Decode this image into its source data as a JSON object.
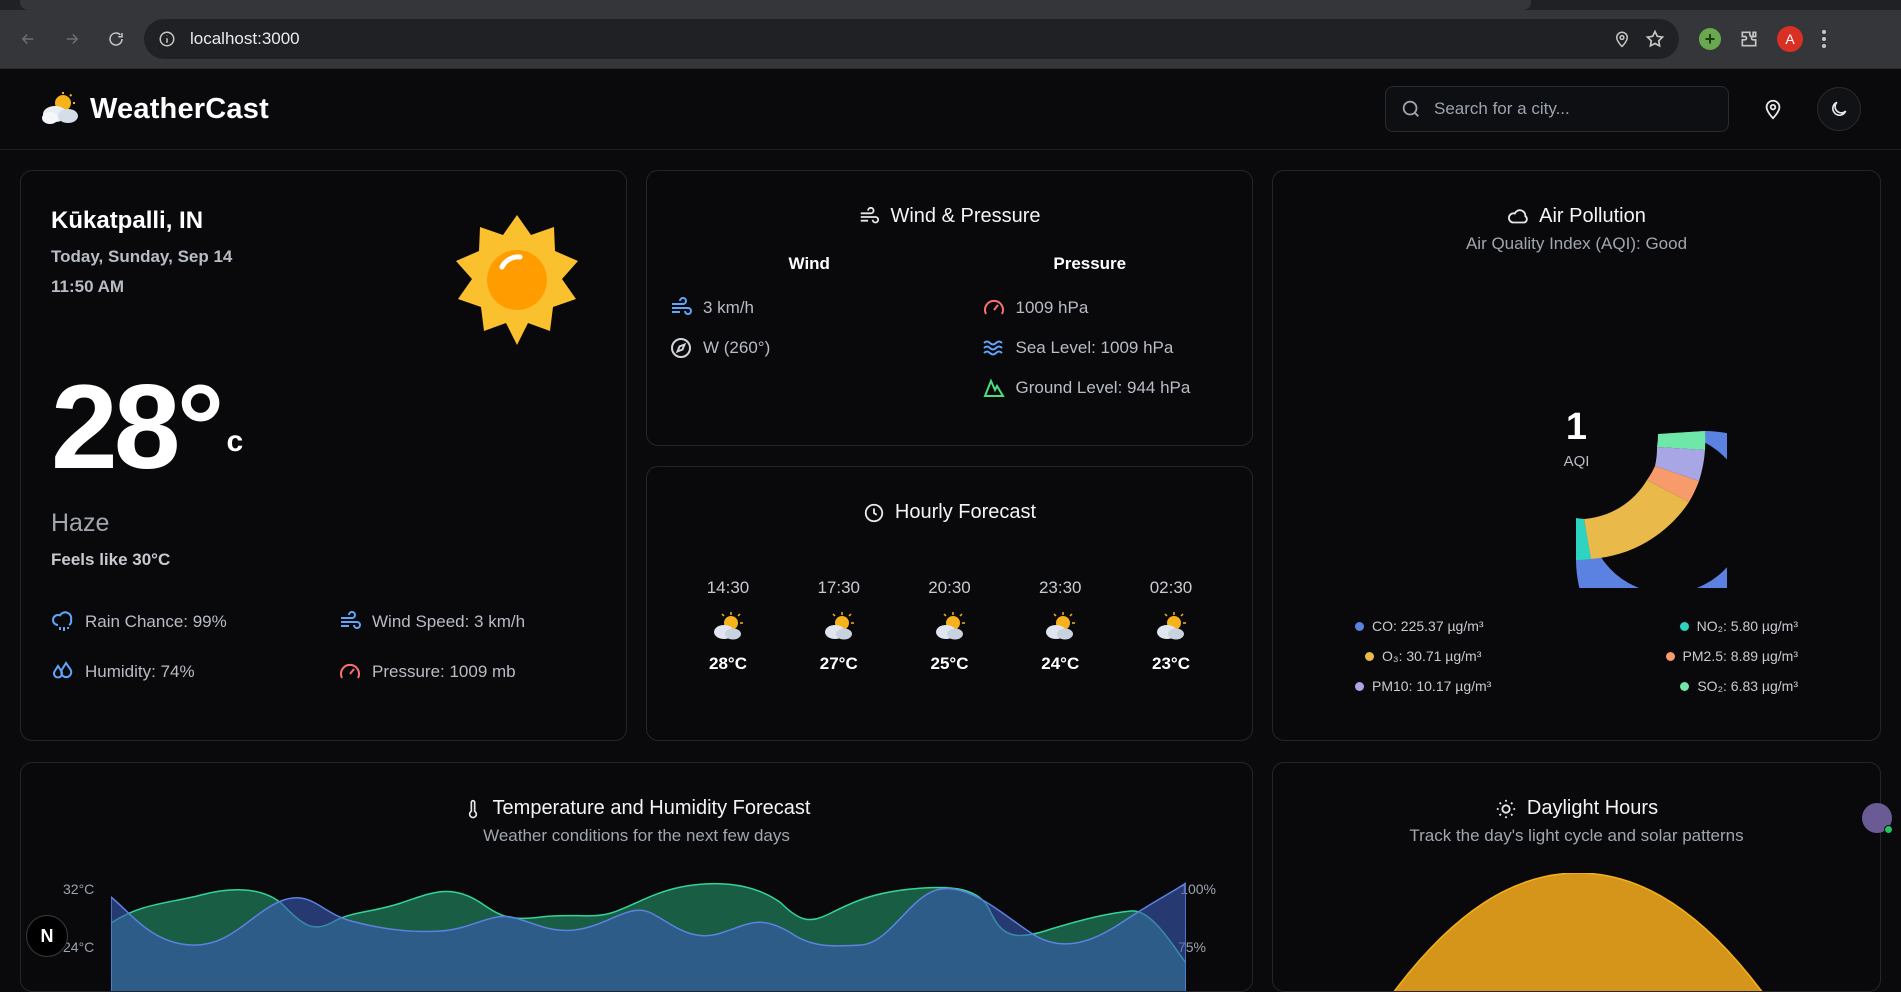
{
  "browser": {
    "url": "localhost:3000",
    "profile_initial": "A"
  },
  "header": {
    "brand": "WeatherCast",
    "search_placeholder": "Search for a city..."
  },
  "current": {
    "city": "Kūkatpalli, IN",
    "date": "Today, Sunday, Sep 14",
    "time": "11:50 AM",
    "temp": "28°",
    "unit": "c",
    "condition": "Haze",
    "feels_like": "Feels like 30°C",
    "stats": {
      "rain": "Rain Chance: 99%",
      "wind": "Wind Speed: 3 km/h",
      "humidity": "Humidity: 74%",
      "pressure": "Pressure: 1009 mb"
    }
  },
  "wind_pressure": {
    "title": "Wind & Pressure",
    "wind_head": "Wind",
    "pressure_head": "Pressure",
    "wind_speed": "3 km/h",
    "wind_dir": "W (260°)",
    "pressure": "1009 hPa",
    "sea_level": "Sea Level: 1009 hPa",
    "ground_level": "Ground Level: 944 hPa"
  },
  "hourly": {
    "title": "Hourly Forecast",
    "items": [
      {
        "time": "14:30",
        "temp": "28°C"
      },
      {
        "time": "17:30",
        "temp": "27°C"
      },
      {
        "time": "20:30",
        "temp": "25°C"
      },
      {
        "time": "23:30",
        "temp": "24°C"
      },
      {
        "time": "02:30",
        "temp": "23°C"
      }
    ]
  },
  "air": {
    "title": "Air Pollution",
    "subtitle": "Air Quality Index (AQI): Good",
    "aqi": "1",
    "aqi_label": "AQI",
    "legend": [
      {
        "label": "CO: 225.37 µg/m³",
        "color": "#5b82e0"
      },
      {
        "label": "NO₂: 5.80 µg/m³",
        "color": "#2dd4bf"
      },
      {
        "label": "O₃: 30.71 µg/m³",
        "color": "#e9b949"
      },
      {
        "label": "PM2.5: 8.89 µg/m³",
        "color": "#f79a6c"
      },
      {
        "label": "PM10: 10.17 µg/m³",
        "color": "#a9a6e6"
      },
      {
        "label": "SO₂: 6.83 µg/m³",
        "color": "#6ee7a8"
      }
    ]
  },
  "temp_chart": {
    "title": "Temperature and Humidity Forecast",
    "subtitle": "Weather conditions for the next few days",
    "left_ticks": [
      "32°C",
      "24°C"
    ],
    "right_ticks": [
      "100%",
      "75%"
    ]
  },
  "daylight": {
    "title": "Daylight Hours",
    "subtitle": "Track the day's light cycle and solar patterns"
  },
  "badge": "N"
}
